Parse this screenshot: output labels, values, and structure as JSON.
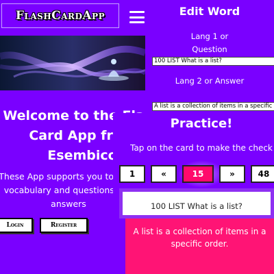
{
  "app": {
    "brand": "FlashCardApp"
  },
  "home": {
    "welcome": "Welcome to the Flash Card App from Esembico",
    "description": "These App supports you to learn vocabulary and questions and answers",
    "login_label": "Login",
    "register_label": "Register"
  },
  "edit": {
    "title": "Edit Word",
    "lang1_label": "Lang 1 or Question",
    "lang1_value": "100 LIST What is a list?",
    "lang2_label": "Lang 2 or Answer",
    "lang2_value": "A list is a collection of items in a specific order."
  },
  "practice": {
    "title": "Practice!",
    "subtitle": "Tap on the card to make the check",
    "pager": {
      "first": "1",
      "prev": "«",
      "current": "15",
      "next": "»",
      "last": "48"
    },
    "question": "100 LIST What is a list?",
    "answer": "A list is a collection of items in a specific order."
  },
  "colors": {
    "background": "#7a00ff",
    "accent": "#ff1475",
    "current_page": "#ff0a6c"
  }
}
